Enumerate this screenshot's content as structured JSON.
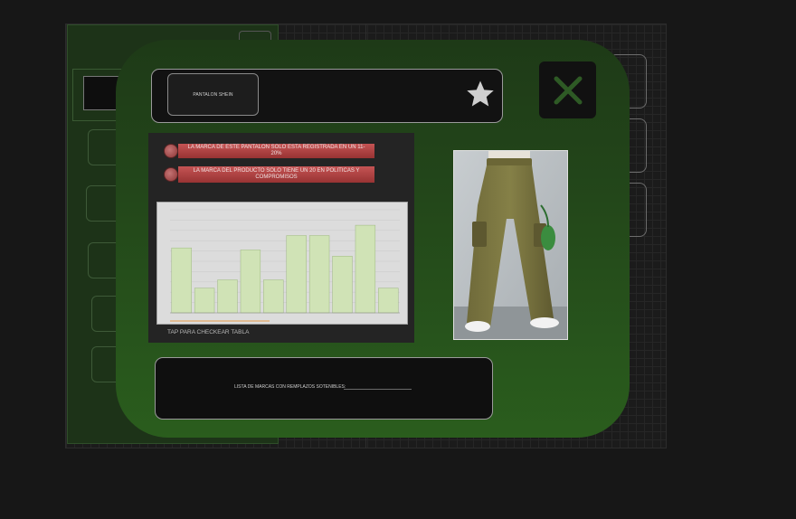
{
  "modal": {
    "product_chip_label": "PANTALON SHEIN",
    "stats": [
      {
        "text": "LA MARCA DE ESTE PANTALON SOLO ESTA REGISTRADA EN UN 11-20%"
      },
      {
        "text": "LA MARCA DEL PRODUCTO SOLO TIENE UN 20 EN POLITICAS Y COMPROMISOS"
      }
    ],
    "chart_caption": "TAP PARA CHECKEAR TABLA",
    "list_button_label": "LISTA DE MARCAS CON REMPLAZOS SOTENIBLES:"
  },
  "icons": {
    "favorite": "star-icon",
    "close": "close-icon",
    "stat": "stat-bullet-icon"
  },
  "colors": {
    "modal_top": "#1e3a17",
    "modal_bottom": "#2a5d1d",
    "close_x": "#2e5a25",
    "star": "#cfcfcf",
    "stat_bar": "#c55454",
    "chart_bar": "#d0e3b6"
  },
  "chart_data": {
    "type": "bar",
    "values": [
      63,
      24,
      32,
      61,
      32,
      75,
      75,
      55,
      85,
      24
    ]
  }
}
